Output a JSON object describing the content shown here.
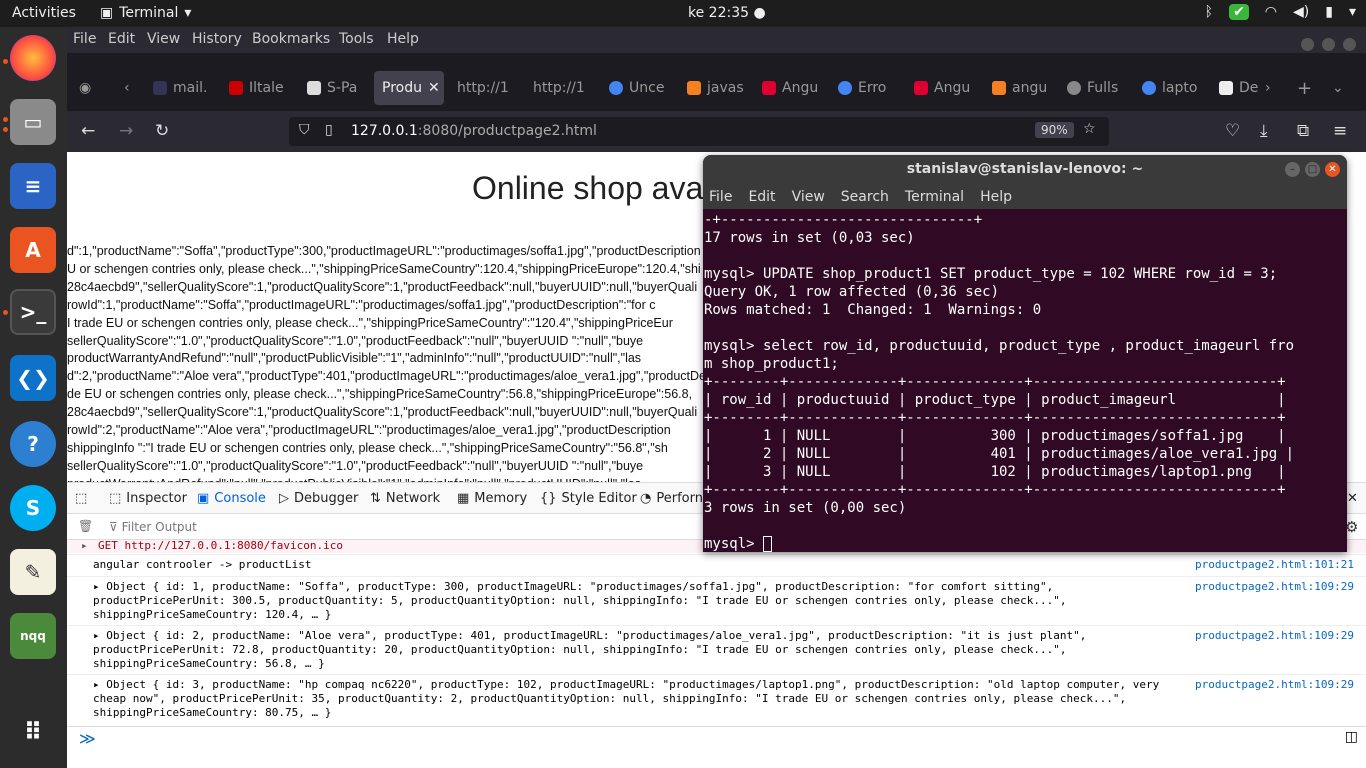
{
  "topbar": {
    "activities": "Activities",
    "app": "Terminal",
    "clock": "ke 22:35"
  },
  "dock": [
    "Firefox",
    "Files",
    "LibreOffice Writer",
    "Ubuntu Software",
    "Terminal",
    "VS Code",
    "Help",
    "Skype",
    "Text Editor",
    "nqq",
    "Show Applications"
  ],
  "ff": {
    "menu": [
      "File",
      "Edit",
      "View",
      "History",
      "Bookmarks",
      "Tools",
      "Help"
    ],
    "tabs": [
      "mail.",
      "Iltale",
      "S-Pa",
      "Produ",
      "http://1",
      "http://1",
      "Unce",
      "javas",
      "Angu",
      "Erro",
      "Angu",
      "angu",
      "Fulls",
      "lapto",
      "De"
    ],
    "url_host": "127.0.0.1",
    "url_rest": ":8080/productpage2.html",
    "zoom": "90%"
  },
  "page": {
    "heading": "Online shop ava",
    "lines": [
      "d\":1,\"productName\":\"Soffa\",\"productType\":300,\"productImageURL\":\"productimages/soffa1.jpg\",\"productDescription",
      "U or schengen contries only, please check...\",\"shippingPriceSameCountry\":120.4,\"shippingPriceEurope\":120.4,\"shi",
      "28c4aecbd9\",\"sellerQualityScore\":1,\"productQualityScore\":1,\"productFeedback\":null,\"buyerUUID\":null,\"buyerQuali",
      "rowId\":1,\"productName\":\"Soffa\",\"productImageURL\":\"productimages/soffa1.jpg\",\"productDescription\":\"for c",
      "I trade EU or schengen contries only, please check...\",\"shippingPriceSameCountry\":\"120.4\",\"shippingPriceEur",
      "sellerQualityScore\":\"1.0\",\"productQualityScore\":\"1.0\",\"productFeedback\":\"null\",\"buyerUUID \":\"null\",\"buye",
      "productWarrantyAndRefund\":\"null\",\"productPublicVisible\":\"1\",\"adminInfo\":\"null\",\"productUUID\":\"null\",\"las",
      "d\":2,\"productName\":\"Aloe vera\",\"productType\":401,\"productImageURL\":\"productimages/aloe_vera1.jpg\",\"productDesc",
      "de EU or schengen contries only, please check...\",\"shippingPriceSameCountry\":56.8,\"shippingPriceEurope\":56.8,",
      "28c4aecbd9\",\"sellerQualityScore\":1,\"productQualityScore\":1,\"productFeedback\":null,\"buyerUUID\":null,\"buyerQuali",
      "rowId\":2,\"productName\":\"Aloe vera\",\"productImageURL\":\"productimages/aloe_vera1.jpg\",\"productDescription",
      "shippingInfo \":\"I trade EU or schengen contries only, please check...\",\"shippingPriceSameCountry\":\"56.8\",\"sh",
      "sellerQualityScore\":\"1.0\",\"productQualityScore\":\"1.0\",\"productFeedback\":\"null\",\"buyerUUID \":\"null\",\"buye",
      "productWarrantyAndRefund\":\"null\",\"productPublicVisible\":\"1\",\"adminInfo\":\"null\",\"productUUID\":\"null\",\"las"
    ]
  },
  "devtools": {
    "tabs": [
      "Inspector",
      "Console",
      "Debugger",
      "Network",
      "Memory",
      "Style Editor",
      "Perforn"
    ],
    "filter": "Filter Output",
    "rows": [
      {
        "text": "GET http://127.0.0.1:8080/favicon.ico",
        "src": ""
      },
      {
        "text": "angular controoler -> productList",
        "src": "productpage2.html:101:21"
      },
      {
        "text": "▸ Object { id: 1, productName: \"Soffa\", productType: 300, productImageURL: \"productimages/soffa1.jpg\", productDescription: \"for comfort sitting\",\nproductPricePerUnit: 300.5, productQuantity: 5, productQuantityOption: null, shippingInfo: \"I trade EU or schengen contries only, please check...\",\nshippingPriceSameCountry: 120.4, … }",
        "src": "productpage2.html:109:29"
      },
      {
        "text": "▸ Object { id: 2, productName: \"Aloe vera\", productType: 401, productImageURL: \"productimages/aloe_vera1.jpg\", productDescription: \"it is just plant\",\nproductPricePerUnit: 72.8, productQuantity: 20, productQuantityOption: null, shippingInfo: \"I trade EU or schengen contries only, please check...\",\nshippingPriceSameCountry: 56.8, … }",
        "src": "productpage2.html:109:29"
      },
      {
        "text": "▸ Object { id: 3, productName: \"hp compaq nc6220\", productType: 102, productImageURL: \"productimages/laptop1.png\", productDescription: \"old laptop computer, very\ncheap now\", productPricePerUnit: 35, productQuantity: 2, productQuantityOption: null, shippingInfo: \"I trade EU or schengen contries only, please check...\",\nshippingPriceSameCountry: 80.75, … }",
        "src": "productpage2.html:109:29"
      }
    ]
  },
  "terminal": {
    "title": "stanislav@stanislav-lenovo: ~",
    "menu": [
      "File",
      "Edit",
      "View",
      "Search",
      "Terminal",
      "Help"
    ],
    "output": "-+------------------------------+\n17 rows in set (0,03 sec)\n\nmysql> UPDATE shop_product1 SET product_type = 102 WHERE row_id = 3;\nQuery OK, 1 row affected (0,36 sec)\nRows matched: 1  Changed: 1  Warnings: 0\n\nmysql> select row_id, productuuid, product_type , product_imageurl fro\nm shop_product1;\n+--------+-------------+--------------+-----------------------------+\n| row_id | productuuid | product_type | product_imageurl            |\n+--------+-------------+--------------+-----------------------------+\n|      1 | NULL        |          300 | productimages/soffa1.jpg    |\n|      2 | NULL        |          401 | productimages/aloe_vera1.jpg |\n|      3 | NULL        |          102 | productimages/laptop1.png   |\n+--------+-------------+--------------+-----------------------------+\n3 rows in set (0,00 sec)\n\nmysql> "
  }
}
